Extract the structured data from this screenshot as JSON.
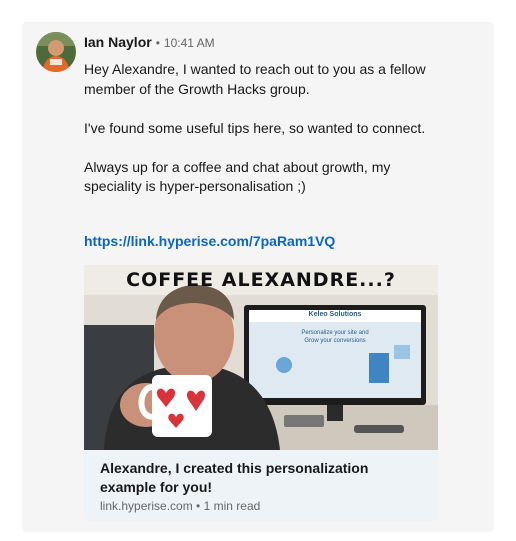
{
  "message": {
    "sender": "Ian Naylor",
    "separator": "•",
    "time": "10:41 AM",
    "paragraphs": [
      "Hey Alexandre, I wanted to reach out to you as a fellow member of the Growth Hacks group.",
      "I've found some useful tips here, so wanted to connect.",
      "Always up for a coffee and chat about growth, my speciality is hyper-personalisation ;)"
    ],
    "link": "https://link.hyperise.com/7paRam1VQ"
  },
  "preview": {
    "image_caption": "COFFEE ALEXANDRE...?",
    "screen_brand": "Keleo Solutions",
    "screen_tagline_1": "Personalize your site and",
    "screen_tagline_2": "Grow your conversions",
    "title": "Alexandre, I created this personalization example for you!",
    "domain": "link.hyperise.com",
    "meta_separator": "•",
    "read_time": "1 min read"
  },
  "colors": {
    "link": "#0a66c2",
    "card_bg": "#eef3f8",
    "message_bg": "#f5f5f5"
  }
}
